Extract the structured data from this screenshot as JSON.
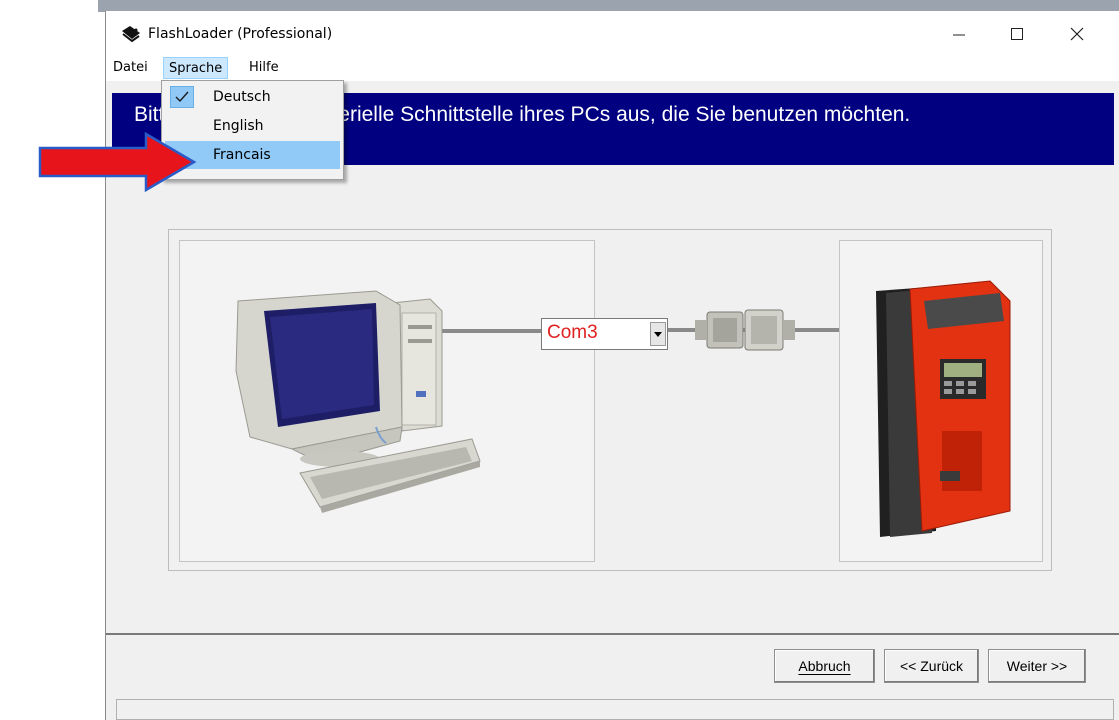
{
  "window": {
    "title": "FlashLoader  (Professional)",
    "controls": {
      "minimize": "—",
      "maximize": "☐",
      "close": "✕"
    }
  },
  "menubar": {
    "items": [
      {
        "label": "Datei"
      },
      {
        "label": "Sprache"
      },
      {
        "label": "Hilfe"
      }
    ]
  },
  "language_menu": {
    "items": [
      {
        "label": "Deutsch",
        "checked": true
      },
      {
        "label": "English",
        "checked": false
      },
      {
        "label": "Francais",
        "highlighted": true
      }
    ]
  },
  "banner": {
    "text": "Bitte wählen Sie die Serielle Schnittstelle ihres PCs aus, die Sie benutzen möchten."
  },
  "port_select": {
    "value": "Com3"
  },
  "buttons": {
    "cancel": "Abbruch",
    "back": "<< Zurück",
    "next": "Weiter >>"
  },
  "colors": {
    "banner_bg": "#000080",
    "menu_highlight": "#91c9f7",
    "port_text": "#e02020",
    "annotation_arrow": "#e8141c"
  },
  "icons": [
    "app-icon",
    "checkmark-icon",
    "dropdown-arrow-icon",
    "annotation-arrow"
  ]
}
